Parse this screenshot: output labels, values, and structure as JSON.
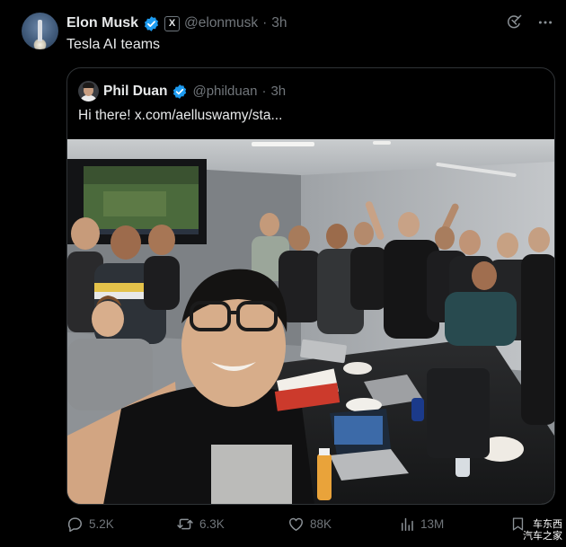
{
  "author": {
    "name": "Elon Musk",
    "handle": "@elonmusk",
    "time": "3h",
    "affiliate_badge": "X"
  },
  "tweet": {
    "text": "Tesla AI teams"
  },
  "quoted": {
    "name": "Phil Duan",
    "handle": "@philduan",
    "time": "3h",
    "text": "Hi there!  x.com/aelluswamy/sta..."
  },
  "actions": {
    "replies": "5.2K",
    "reposts": "6.3K",
    "likes": "88K",
    "views": "13M"
  },
  "watermark": {
    "line1": "车东西",
    "line2": "汽车之家"
  },
  "colors": {
    "background": "#000000",
    "text": "#e7e9ea",
    "muted": "#71767b",
    "verified": "#1d9bf0",
    "border": "#2f3336"
  },
  "icons": [
    "verified-icon",
    "grok-icon",
    "more-icon",
    "reply-icon",
    "repost-icon",
    "like-icon",
    "views-icon",
    "bookmark-icon"
  ]
}
